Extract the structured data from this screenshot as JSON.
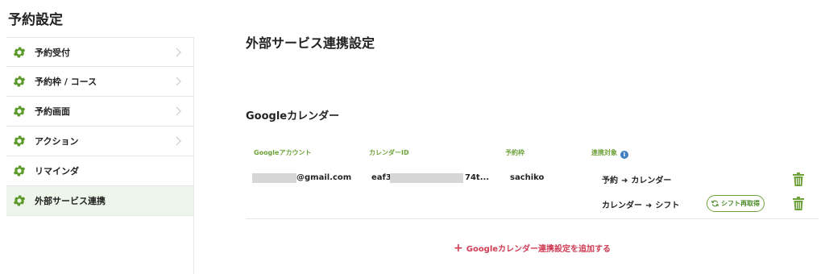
{
  "page": {
    "title": "予約設定"
  },
  "sidebar": {
    "items": [
      {
        "label": "予約受付",
        "has_chevron": true,
        "active": false
      },
      {
        "label": "予約枠 / コース",
        "has_chevron": true,
        "active": false
      },
      {
        "label": "予約画面",
        "has_chevron": true,
        "active": false
      },
      {
        "label": "アクション",
        "has_chevron": true,
        "active": false
      },
      {
        "label": "リマインダ",
        "has_chevron": false,
        "active": false
      },
      {
        "label": "外部サービス連携",
        "has_chevron": false,
        "active": true
      }
    ],
    "icon": "gear-icon"
  },
  "main": {
    "title": "外部サービス連携設定",
    "section_title": "Googleカレンダー",
    "table": {
      "headers": {
        "account": "Googleアカウント",
        "calendar_id": "カレンダーID",
        "slot": "予約枠",
        "target": "連携対象"
      },
      "row": {
        "account_suffix": "@gmail.com",
        "calendar_id_prefix": "eaf3",
        "calendar_id_suffix": "74t...",
        "slot": "sachiko",
        "targets": [
          {
            "from": "予約",
            "to": "カレンダー"
          },
          {
            "from": "カレンダー",
            "to": "シフト"
          }
        ]
      },
      "refetch_button": "シフト再取得"
    },
    "add_link": "Googleカレンダー連携設定を追加する"
  },
  "colors": {
    "accent_green": "#6ea23a",
    "active_bg": "#eef5ea",
    "add_link_red": "#d03c54",
    "info_blue": "#3f7fc2"
  }
}
